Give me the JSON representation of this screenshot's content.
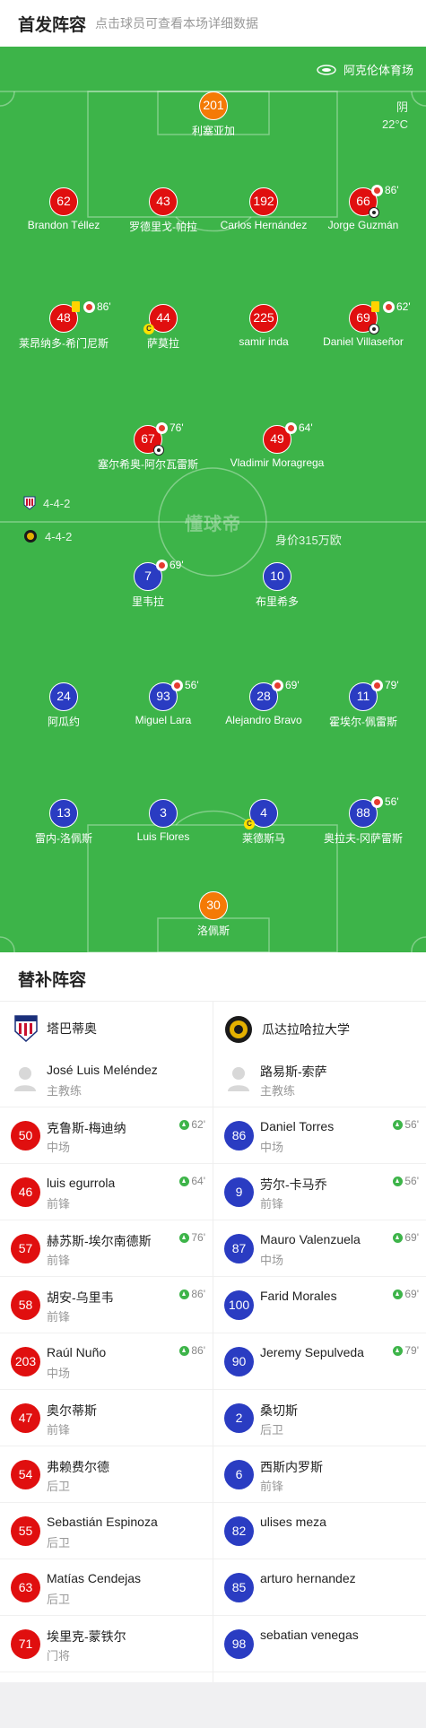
{
  "header": {
    "title": "首发阵容",
    "subtitle": "点击球员可查看本场详细数据"
  },
  "field": {
    "venue": "阿克伦体育场",
    "weather": "阴",
    "temperature": "22°C",
    "home_formation": "4-4-2",
    "away_formation": "4-4-2",
    "away_value": "身价315万欧",
    "watermark": "懂球帝"
  },
  "home_players": [
    {
      "num": "201",
      "name": "利塞亚加",
      "color": "orange"
    },
    {
      "num": "62",
      "name": "Brandon Téllez"
    },
    {
      "num": "43",
      "name": "罗德里戈-帕拉"
    },
    {
      "num": "192",
      "name": "Carlos Hernández"
    },
    {
      "num": "66",
      "name": "Jorge Guzmán",
      "sub": "86'"
    },
    {
      "num": "48",
      "name": "莱昂纳多-希门尼斯",
      "sub": "86'"
    },
    {
      "num": "44",
      "name": "萨莫拉"
    },
    {
      "num": "225",
      "name": "samir inda"
    },
    {
      "num": "69",
      "name": "Daniel Villaseñor",
      "sub": "62'"
    },
    {
      "num": "67",
      "name": "塞尔希奥-阿尔瓦雷斯",
      "sub": "76'"
    },
    {
      "num": "49",
      "name": "Vladimir Moragrega",
      "sub": "64'"
    }
  ],
  "away_players": [
    {
      "num": "7",
      "name": "里韦拉",
      "sub": "69'"
    },
    {
      "num": "10",
      "name": "布里希多"
    },
    {
      "num": "24",
      "name": "阿瓜约"
    },
    {
      "num": "93",
      "name": "Miguel Lara",
      "sub": "56'"
    },
    {
      "num": "28",
      "name": "Alejandro Bravo",
      "sub": "69'"
    },
    {
      "num": "11",
      "name": "霍埃尔-佩雷斯",
      "sub": "79'"
    },
    {
      "num": "13",
      "name": "雷内-洛佩斯"
    },
    {
      "num": "3",
      "name": "Luis Flores"
    },
    {
      "num": "4",
      "name": "莱德斯马"
    },
    {
      "num": "88",
      "name": "奥拉夫-冈萨雷斯",
      "sub": "56'"
    },
    {
      "num": "30",
      "name": "洛佩斯",
      "color": "orange"
    }
  ],
  "subs": {
    "title": "替补阵容",
    "home_team": "塔巴蒂奥",
    "away_team": "瓜达拉哈拉大学",
    "home_coach": {
      "name": "José Luis Meléndez",
      "role": "主教练"
    },
    "away_coach": {
      "name": "路易斯-索萨",
      "role": "主教练"
    },
    "home": [
      {
        "num": "50",
        "name": "克鲁斯-梅迪纳",
        "pos": "中场",
        "in": "62'"
      },
      {
        "num": "46",
        "name": "luis egurrola",
        "pos": "前锋",
        "in": "64'"
      },
      {
        "num": "57",
        "name": "赫苏斯-埃尔南德斯",
        "pos": "前锋",
        "in": "76'"
      },
      {
        "num": "58",
        "name": "胡安-乌里韦",
        "pos": "前锋",
        "in": "86'"
      },
      {
        "num": "203",
        "name": "Raúl Nuño",
        "pos": "中场",
        "in": "86'"
      },
      {
        "num": "47",
        "name": "奥尔蒂斯",
        "pos": "前锋",
        "in": ""
      },
      {
        "num": "54",
        "name": "弗赖费尔德",
        "pos": "后卫",
        "in": ""
      },
      {
        "num": "55",
        "name": "Sebastián Espinoza",
        "pos": "后卫",
        "in": ""
      },
      {
        "num": "63",
        "name": "Matías Cendejas",
        "pos": "后卫",
        "in": ""
      },
      {
        "num": "71",
        "name": "埃里克-蒙铁尔",
        "pos": "门将",
        "in": ""
      }
    ],
    "away": [
      {
        "num": "86",
        "name": "Daniel Torres",
        "pos": "中场",
        "in": "56'"
      },
      {
        "num": "9",
        "name": "劳尔-卡马乔",
        "pos": "前锋",
        "in": "56'"
      },
      {
        "num": "87",
        "name": "Mauro Valenzuela",
        "pos": "中场",
        "in": "69'"
      },
      {
        "num": "100",
        "name": "Farid Morales",
        "pos": "",
        "in": "69'"
      },
      {
        "num": "90",
        "name": "Jeremy Sepulveda",
        "pos": "",
        "in": "79'"
      },
      {
        "num": "2",
        "name": "桑切斯",
        "pos": "后卫",
        "in": ""
      },
      {
        "num": "6",
        "name": "西斯内罗斯",
        "pos": "前锋",
        "in": ""
      },
      {
        "num": "82",
        "name": "ulises meza",
        "pos": "",
        "in": ""
      },
      {
        "num": "85",
        "name": "arturo hernandez",
        "pos": "",
        "in": ""
      },
      {
        "num": "98",
        "name": "sebatian venegas",
        "pos": "",
        "in": ""
      }
    ]
  },
  "colors": {
    "pitch": "#3db449",
    "home": "#e00f0f",
    "away": "#2a3cc2",
    "keeper": "#f47a06"
  }
}
